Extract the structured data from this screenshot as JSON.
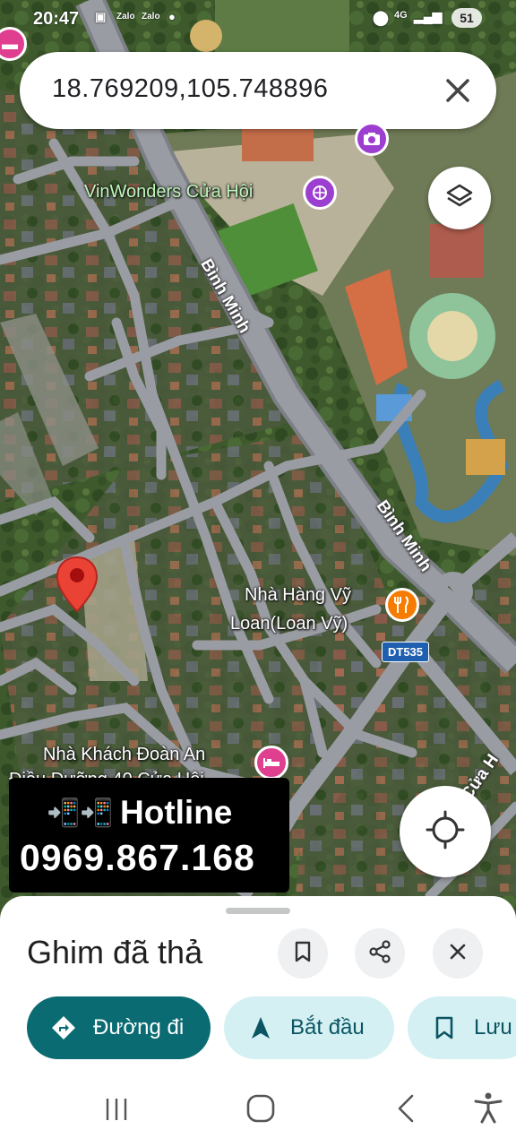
{
  "status_bar": {
    "time": "20:47",
    "notification_icons": [
      "gallery-icon",
      "zalo-icon",
      "zalo-icon",
      "dot-icon"
    ],
    "zalo_label": "Zalo",
    "network": "4G",
    "battery": "51"
  },
  "search": {
    "query": "18.769209,105.748896"
  },
  "map": {
    "road_labels": [
      "Bình Minh",
      "Bình Minh",
      "Cửa H"
    ],
    "route_badge": "DT535",
    "pois": [
      {
        "name": "VinWonders Cửa Hội",
        "icon": "amusement-park-icon",
        "color": "#9c3fd1"
      },
      {
        "name_line1": "Nhà Hàng Vỹ",
        "name_line2": "Loan(Loan Vỹ)",
        "icon": "restaurant-icon",
        "color": "#f57c00"
      },
      {
        "name_line1": "Nhà Khách Đoàn An",
        "name_line2": "Điều Dưỡng 40 Cửa Hội",
        "icon": "hotel-icon",
        "color": "#e03e8f"
      }
    ],
    "dropped_pin_color": "#ea4335"
  },
  "overlay": {
    "hotline_title": "Hotline",
    "hotline_number": "0969.867.168",
    "phone_icons": "📲📲"
  },
  "sheet": {
    "title": "Ghim đã thả",
    "actions": [
      {
        "label": "Đường đi",
        "icon": "directions-icon"
      },
      {
        "label": "Bắt đầu",
        "icon": "navigation-arrow-icon"
      },
      {
        "label": "Lưu",
        "icon": "bookmark-icon"
      }
    ]
  },
  "colors": {
    "accent_teal": "#0b6b72",
    "pill_light": "#d4f0f3",
    "accent_text": "#0b5563"
  }
}
